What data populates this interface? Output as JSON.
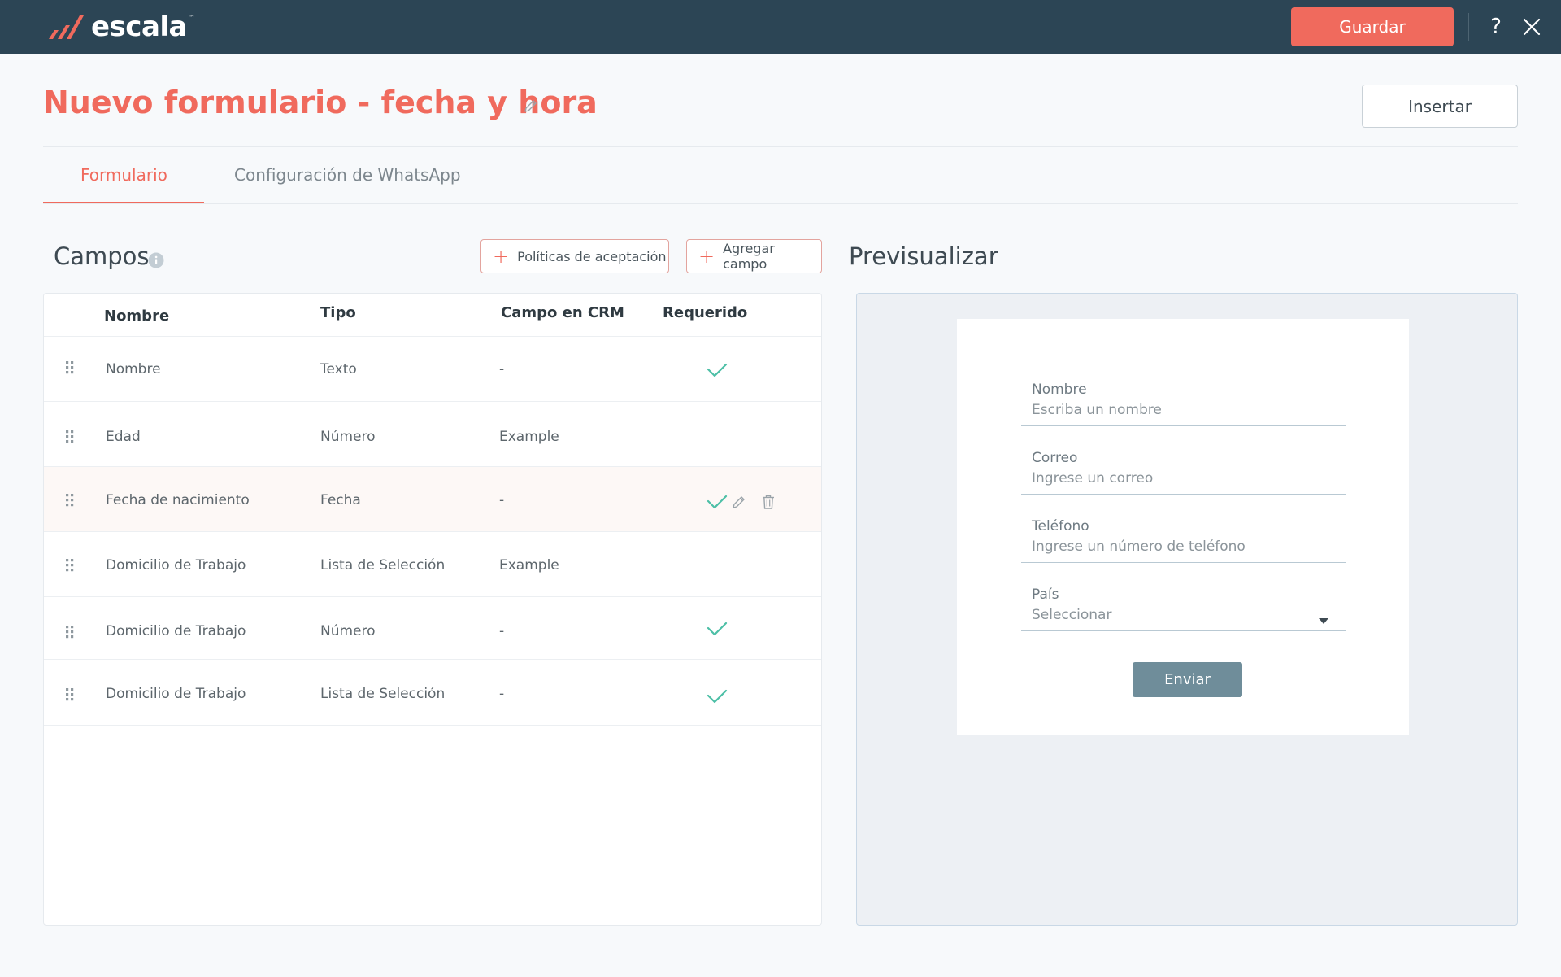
{
  "app": {
    "logo_text": "escala",
    "logo_tm": "™"
  },
  "topbar": {
    "save_label": "Guardar",
    "help_label": "?"
  },
  "header": {
    "title": "Nuevo formulario - fecha y hora",
    "insert_label": "Insertar"
  },
  "tabs": [
    {
      "label": "Formulario",
      "active": true
    },
    {
      "label": "Configuración de WhatsApp",
      "active": false
    }
  ],
  "fields": {
    "title": "Campos",
    "policies_button": "Políticas de aceptación",
    "add_field_button": "Agregar campo",
    "columns": [
      "Nombre",
      "Tipo",
      "Campo en CRM",
      "Requerido"
    ],
    "rows": [
      {
        "name": "Nombre",
        "type": "Texto",
        "crm": "-",
        "required": true
      },
      {
        "name": "Edad",
        "type": "Número",
        "crm": "Example",
        "required": false
      },
      {
        "name": "Fecha de nacimiento",
        "type": "Fecha",
        "crm": "-",
        "required": true
      },
      {
        "name": "Domicilio de Trabajo",
        "type": "Lista de Selección",
        "crm": "Example",
        "required": false
      },
      {
        "name": "Domicilio de Trabajo",
        "type": "Número",
        "crm": "-",
        "required": true
      },
      {
        "name": "Domicilio de Trabajo",
        "type": "Lista de Selección",
        "crm": "-",
        "required": true
      }
    ]
  },
  "preview": {
    "title": "Previsualizar",
    "form": {
      "fields": [
        {
          "label": "Nombre",
          "placeholder": "Escriba un nombre"
        },
        {
          "label": "Correo",
          "placeholder": "Ingrese un correo"
        },
        {
          "label": "Teléfono",
          "placeholder": "Ingrese un número de teléfono"
        },
        {
          "label": "País",
          "placeholder": "Seleccionar"
        }
      ],
      "submit_label": "Enviar"
    }
  },
  "colors": {
    "brand": "#f06a5d",
    "topbar": "#2c4555",
    "check": "#4cbfa6",
    "submit": "#6f8d9a"
  }
}
